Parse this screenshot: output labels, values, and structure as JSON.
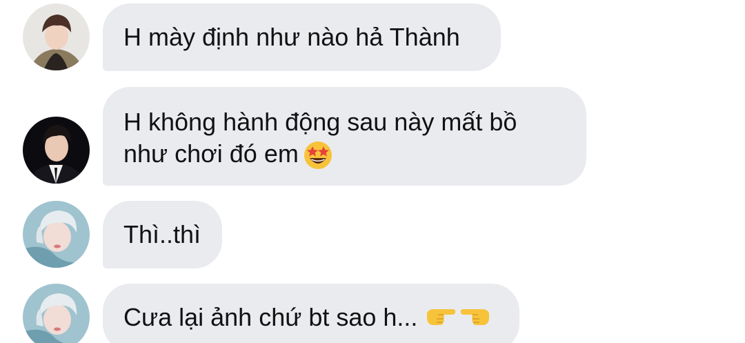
{
  "messages": [
    {
      "sender_avatar": "avatar-boy-beige-jacket",
      "lines": [
        "H mày định như nào hả Thành"
      ],
      "emoji": []
    },
    {
      "sender_avatar": "avatar-boy-black-suit",
      "lines": [
        "H không hành động sau này mất bồ",
        "như chơi đó em"
      ],
      "emoji": [
        "star-struck-emoji"
      ]
    },
    {
      "sender_avatar": "avatar-pale-hair",
      "lines": [
        "Thì..thì"
      ],
      "emoji": []
    },
    {
      "sender_avatar": "avatar-pale-hair",
      "lines": [
        "Cưa lại ảnh chứ bt sao h..."
      ],
      "emoji": [
        "backhand-index-pointing-right-emoji",
        "backhand-index-pointing-left-emoji"
      ]
    }
  ],
  "colors": {
    "bubble": "#e9ebef",
    "text": "#111111",
    "background": "#ffffff"
  }
}
